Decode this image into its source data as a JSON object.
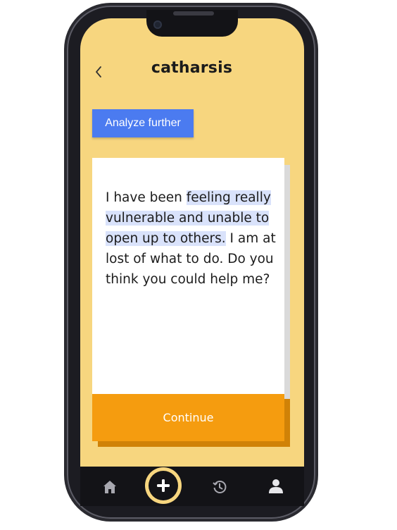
{
  "app": {
    "title": "catharsis"
  },
  "header": {
    "back_icon": "chevron-left-icon"
  },
  "actions": {
    "analyze_label": "Analyze further",
    "continue_label": "Continue"
  },
  "entry": {
    "text_before": "I have been ",
    "text_highlight": "feeling really vulnerable and unable to open up to others.",
    "text_after": " I am at lost of what to do. Do you think you could help me?"
  },
  "nav": {
    "items": [
      {
        "icon": "home-icon"
      },
      {
        "icon": "plus-icon"
      },
      {
        "icon": "history-icon"
      },
      {
        "icon": "user-icon"
      }
    ]
  },
  "colors": {
    "background": "#f7d67f",
    "accent_blue": "#4b7bf0",
    "accent_orange": "#f59c0f",
    "highlight": "#d9e2fb",
    "dark": "#131317"
  }
}
